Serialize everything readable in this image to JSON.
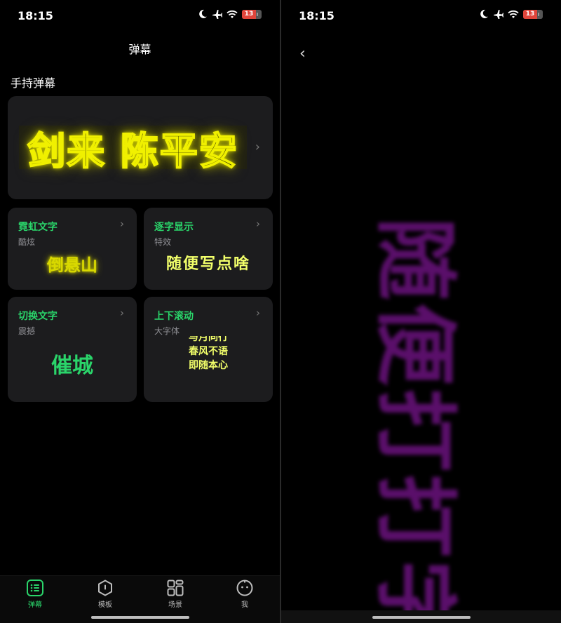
{
  "status_left": {
    "time": "18:15",
    "battery": "13"
  },
  "status_right": {
    "time": "18:15",
    "battery": "13"
  },
  "header": {
    "title": "弹幕"
  },
  "section": {
    "title": "手持弹幕"
  },
  "hero": {
    "text": "剑来 陈平安"
  },
  "cards": [
    {
      "title": "霓虹文字",
      "subtitle": "酷炫",
      "preview": "倒悬山"
    },
    {
      "title": "逐字显示",
      "subtitle": "特效",
      "preview": "随便写点啥"
    },
    {
      "title": "切换文字",
      "subtitle": "震撼",
      "preview": "催城"
    },
    {
      "title": "上下滚动",
      "subtitle": "大字体",
      "preview_lines": [
        "与月同行",
        "春风不语",
        "即随本心"
      ]
    }
  ],
  "tabs": [
    {
      "label": "弹幕",
      "icon": "list-icon",
      "active": true
    },
    {
      "label": "模板",
      "icon": "template-icon",
      "active": false
    },
    {
      "label": "场景",
      "icon": "grid-icon",
      "active": false
    },
    {
      "label": "我",
      "icon": "profile-icon",
      "active": false
    }
  ],
  "right_screen": {
    "banner_text": "随便打打字"
  },
  "colors": {
    "accent": "#2ad46a",
    "neon_yellow": "#f0f000",
    "banner_purple": "#5a0f6a",
    "card_bg": "#1c1c1e"
  }
}
